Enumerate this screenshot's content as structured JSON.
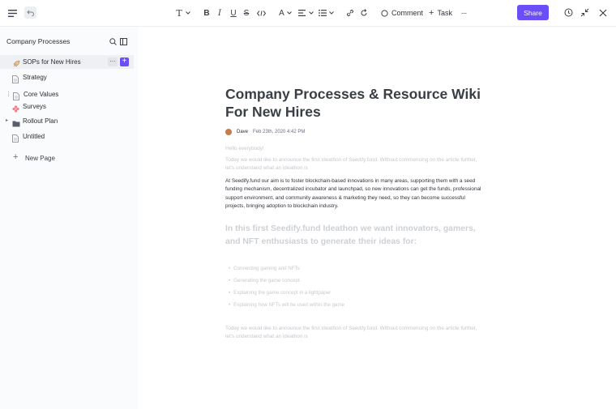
{
  "toolbar": {
    "comment_label": "Comment",
    "task_label": "Task",
    "share_label": "Share",
    "accent_color": "#6b4ef6"
  },
  "sidebar": {
    "title": "Company Processes",
    "items": [
      {
        "label": "SOPs for New Hires",
        "icon": "rocket-icon"
      },
      {
        "label": "Strategy",
        "icon": "document-icon"
      },
      {
        "label": "Core Values",
        "icon": "document-icon"
      },
      {
        "label": "Surveys",
        "icon": "flower-icon"
      },
      {
        "label": "Rollout Plan",
        "icon": "folder-icon"
      },
      {
        "label": "Untitled",
        "icon": "document-icon"
      }
    ],
    "new_page_label": "New Page"
  },
  "doc": {
    "title": "Company Processes & Resource Wiki For New Hires",
    "author": "Dave",
    "date": "Feb 23th, 2020  4:42 PM",
    "greeting": "Hello everybody!",
    "intro": "Today we would like to announce the first Ideathon of Seedify.fund. Without commencing on the article further, let's understand what an ideathon is",
    "body": "At Seedify.fund our aim is to foster blockchain-based innovations in many areas, supporting them with a seed funding mechanism, decentralized incubator and launchpad, so new innovations can get the funds, professional support environment, and community awareness & marketing they need, so they can become successful projects, bringing adoption to blockchain industry.",
    "heading": "In this first Seedify.fund Ideathon we want innovators, gamers, and NFT enthusiasts to generate their ideas for:",
    "bullets": [
      "Connecting gaming and NFTs",
      "Generating the game concept",
      "Explaining the game concept in a lightpaper",
      "Explaining how NFTs will be used within the game"
    ],
    "outro": "Today we would like to announce the first Ideathon of Seedify.fund. Without commencing on the article further, let's understand what an ideathon is"
  }
}
